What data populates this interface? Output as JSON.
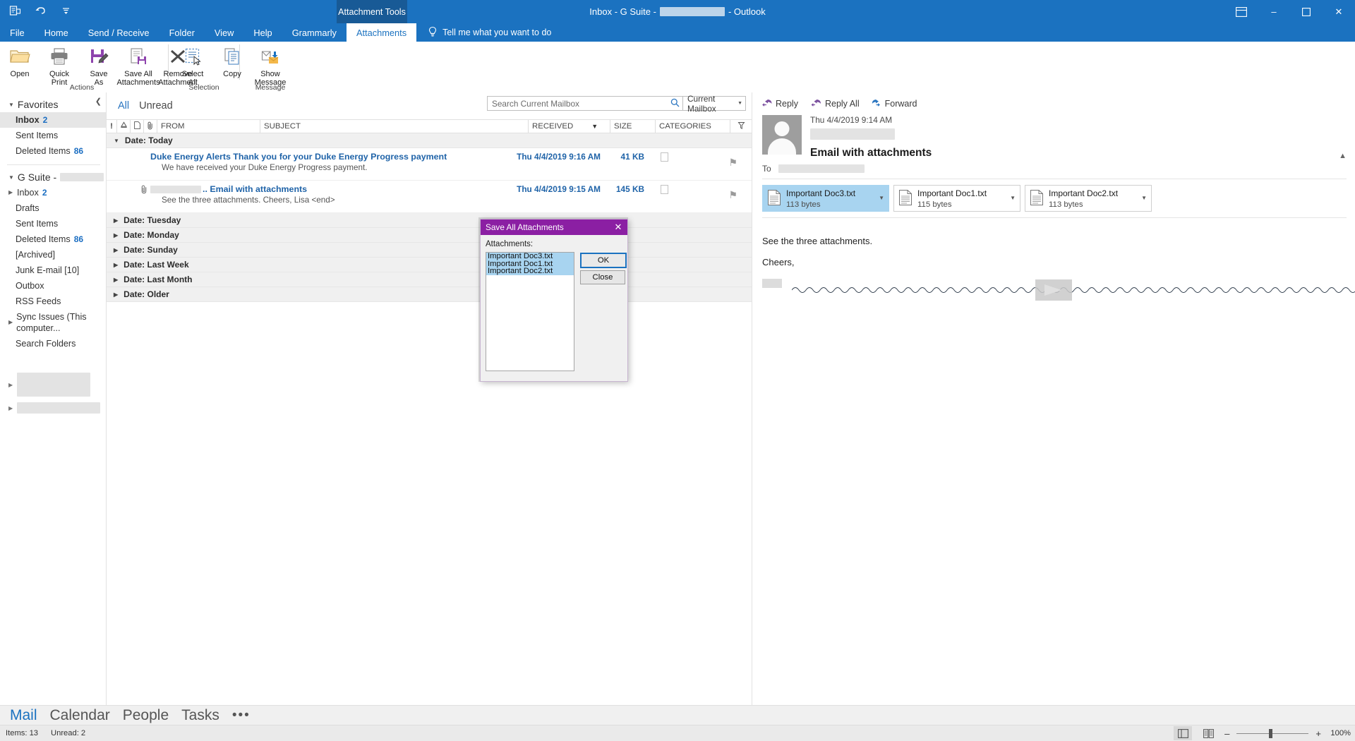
{
  "window": {
    "tool_tab": "Attachment Tools",
    "title_prefix": "Inbox - G Suite -",
    "title_suffix": "- Outlook",
    "minimize": "–",
    "maximize": "❑",
    "close": "✕",
    "qat_icons": [
      "save-send-icon",
      "undo-icon",
      "customize-qat-icon"
    ],
    "ribbon_display_icon": "ribbon-display-options-icon"
  },
  "ribbon": {
    "tabs": [
      {
        "label": "File",
        "active": false
      },
      {
        "label": "Home",
        "active": false
      },
      {
        "label": "Send / Receive",
        "active": false
      },
      {
        "label": "Folder",
        "active": false
      },
      {
        "label": "View",
        "active": false
      },
      {
        "label": "Help",
        "active": false
      },
      {
        "label": "Grammarly",
        "active": false
      },
      {
        "label": "Attachments",
        "active": true
      }
    ],
    "tell_me": "Tell me what you want to do",
    "groups": [
      {
        "label": "Actions",
        "buttons": [
          {
            "label": "Open",
            "icon": "open-folder-icon"
          },
          {
            "label": "Quick\nPrint",
            "line1": "Quick",
            "line2": "Print",
            "icon": "printer-icon"
          },
          {
            "label": "Save\nAs",
            "line1": "Save",
            "line2": "As",
            "icon": "save-as-icon"
          },
          {
            "label": "Save All\nAttachments",
            "line1": "Save All",
            "line2": "Attachments",
            "icon": "save-all-attachments-icon"
          },
          {
            "label": "Remove\nAttachment",
            "line1": "Remove",
            "line2": "Attachment",
            "icon": "remove-attachment-icon"
          }
        ]
      },
      {
        "label": "Selection",
        "buttons": [
          {
            "label": "Select\nAll",
            "line1": "Select",
            "line2": "All",
            "icon": "select-all-icon"
          },
          {
            "label": "Copy",
            "line1": "Copy",
            "line2": "",
            "icon": "copy-icon"
          }
        ]
      },
      {
        "label": "Message",
        "buttons": [
          {
            "label": "Show\nMessage",
            "line1": "Show",
            "line2": "Message",
            "icon": "show-message-icon"
          }
        ]
      }
    ]
  },
  "sidebar": {
    "favorites": {
      "header": "Favorites",
      "items": [
        {
          "label": "Inbox",
          "count": "2",
          "selected": true
        },
        {
          "label": "Sent Items",
          "count": "",
          "selected": false
        },
        {
          "label": "Deleted Items",
          "count": "86",
          "selected": false
        }
      ]
    },
    "account": {
      "header": "G Suite -",
      "header_redacted": true,
      "items": [
        {
          "label": "Inbox",
          "count": "2",
          "expandable": true
        },
        {
          "label": "Drafts",
          "count": "",
          "expandable": false
        },
        {
          "label": "Sent Items",
          "count": "",
          "expandable": false
        },
        {
          "label": "Deleted Items",
          "count": "86",
          "expandable": false
        },
        {
          "label": "[Archived]",
          "count": "",
          "expandable": false
        },
        {
          "label": "Junk E-mail [10]",
          "count": "",
          "expandable": false
        },
        {
          "label": "Outbox",
          "count": "",
          "expandable": false
        },
        {
          "label": "RSS Feeds",
          "count": "",
          "expandable": false
        },
        {
          "label": "Sync Issues (This computer...",
          "count": "",
          "expandable": true
        },
        {
          "label": "Search Folders",
          "count": "",
          "expandable": false
        }
      ]
    }
  },
  "message_list": {
    "filters": [
      {
        "label": "All",
        "active": true
      },
      {
        "label": "Unread",
        "active": false
      }
    ],
    "search": {
      "placeholder": "Search Current Mailbox",
      "scope": "Current Mailbox",
      "icon": "search-icon"
    },
    "columns": [
      {
        "label": "!",
        "icon": "importance-icon"
      },
      {
        "label": "",
        "icon": "reminder-bell-icon"
      },
      {
        "label": "",
        "icon": "document-icon"
      },
      {
        "label": "",
        "icon": "paperclip-icon"
      },
      {
        "label": "FROM",
        "icon": ""
      },
      {
        "label": "SUBJECT",
        "icon": ""
      },
      {
        "label": "RECEIVED",
        "icon": "sort-descending-icon"
      },
      {
        "label": "SIZE",
        "icon": ""
      },
      {
        "label": "CATEGORIES",
        "icon": ""
      },
      {
        "label": "",
        "icon": "flag-filter-icon"
      }
    ],
    "groups": [
      {
        "label": "Date: Today",
        "expanded": true,
        "messages": [
          {
            "subject": "Duke Energy Alerts Thank you for your Duke Energy Progress payment",
            "preview": "We have received your Duke Energy Progress payment.",
            "received": "Thu 4/4/2019 9:16 AM",
            "size": "41 KB",
            "has_attachment": false,
            "from_redacted": false
          },
          {
            "subject": ".. Email with attachments",
            "preview": "See the three attachments.  Cheers,  Lisa <end>",
            "received": "Thu 4/4/2019 9:15 AM",
            "size": "145 KB",
            "has_attachment": true,
            "from_redacted": true
          }
        ]
      },
      {
        "label": "Date: Tuesday",
        "expanded": false,
        "messages": []
      },
      {
        "label": "Date: Monday",
        "expanded": false,
        "messages": []
      },
      {
        "label": "Date: Sunday",
        "expanded": false,
        "messages": []
      },
      {
        "label": "Date: Last Week",
        "expanded": false,
        "messages": []
      },
      {
        "label": "Date: Last Month",
        "expanded": false,
        "messages": []
      },
      {
        "label": "Date: Older",
        "expanded": false,
        "messages": []
      }
    ]
  },
  "reading_pane": {
    "actions": [
      {
        "label": "Reply",
        "icon": "reply-icon"
      },
      {
        "label": "Reply All",
        "icon": "reply-all-icon"
      },
      {
        "label": "Forward",
        "icon": "forward-icon"
      }
    ],
    "date": "Thu 4/4/2019 9:14 AM",
    "sender_redacted": true,
    "subject": "Email with attachments",
    "to_label": "To",
    "to_redacted": true,
    "attachments": [
      {
        "name": "Important Doc3.txt",
        "size": "113 bytes",
        "selected": true
      },
      {
        "name": "Important Doc1.txt",
        "size": "115 bytes",
        "selected": false
      },
      {
        "name": "Important Doc2.txt",
        "size": "113 bytes",
        "selected": false
      }
    ],
    "body_lines": [
      "See the three attachments.",
      "Cheers,"
    ],
    "signature_redacted": true
  },
  "dialog": {
    "title": "Save All Attachments",
    "close_icon": "close-icon",
    "label": "Attachments:",
    "items": [
      {
        "name": "Important Doc3.txt",
        "selected": true
      },
      {
        "name": "Important Doc1.txt",
        "selected": true
      },
      {
        "name": "Important Doc2.txt",
        "selected": true
      }
    ],
    "buttons": [
      {
        "label": "OK",
        "primary": true
      },
      {
        "label": "Close",
        "primary": false
      }
    ]
  },
  "bottom_nav": [
    {
      "label": "Mail",
      "active": true
    },
    {
      "label": "Calendar",
      "active": false
    },
    {
      "label": "People",
      "active": false
    },
    {
      "label": "Tasks",
      "active": false
    },
    {
      "label": "•••",
      "active": false
    }
  ],
  "status_bar": {
    "items_text": "Items: 13",
    "unread_text": "Unread: 2",
    "normal_view_icon": "normal-view-icon",
    "reading_view_icon": "reading-view-icon",
    "zoom_out": "–",
    "zoom_in": "+",
    "zoom_level": "100%"
  },
  "colors": {
    "accent": "#1b72c0",
    "dialog_title": "#8b1fa3",
    "link": "#1f63a8",
    "selection": "#a8d4f0"
  }
}
